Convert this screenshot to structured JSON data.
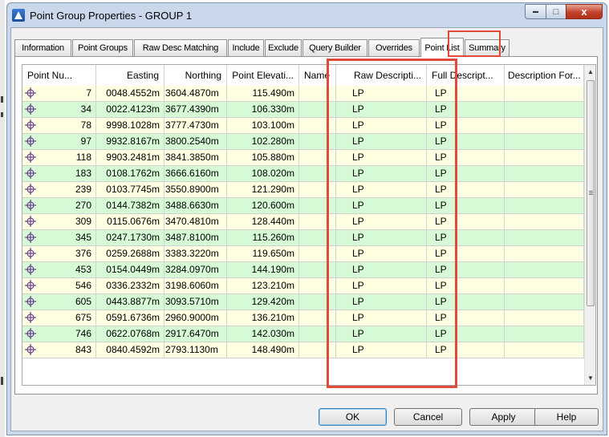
{
  "window": {
    "title": "Point Group Properties - GROUP 1"
  },
  "window_controls": {
    "minimize": "▬",
    "maximize": "□",
    "close": "x"
  },
  "tabs": [
    "Information",
    "Point Groups",
    "Raw Desc Matching",
    "Include",
    "Exclude",
    "Query Builder",
    "Overrides",
    "Point List",
    "Summary"
  ],
  "active_tab": "Point List",
  "columns": [
    "Point Nu...",
    "Easting",
    "Northing",
    "Point Elevati...",
    "Name",
    "Raw Descripti...",
    "Full Descript...",
    "Description For..."
  ],
  "rows": [
    {
      "number": "7",
      "easting": "0048.4552m",
      "northing": "3604.4870m",
      "elevation": "115.490m",
      "name": "",
      "raw_desc": "LP",
      "full_desc": "LP",
      "desc_format": ""
    },
    {
      "number": "34",
      "easting": "0022.4123m",
      "northing": "3677.4390m",
      "elevation": "106.330m",
      "name": "",
      "raw_desc": "LP",
      "full_desc": "LP",
      "desc_format": ""
    },
    {
      "number": "78",
      "easting": "9998.1028m",
      "northing": "3777.4730m",
      "elevation": "103.100m",
      "name": "",
      "raw_desc": "LP",
      "full_desc": "LP",
      "desc_format": ""
    },
    {
      "number": "97",
      "easting": "9932.8167m",
      "northing": "3800.2540m",
      "elevation": "102.280m",
      "name": "",
      "raw_desc": "LP",
      "full_desc": "LP",
      "desc_format": ""
    },
    {
      "number": "118",
      "easting": "9903.2481m",
      "northing": "3841.3850m",
      "elevation": "105.880m",
      "name": "",
      "raw_desc": "LP",
      "full_desc": "LP",
      "desc_format": ""
    },
    {
      "number": "183",
      "easting": "0108.1762m",
      "northing": "3666.6160m",
      "elevation": "108.020m",
      "name": "",
      "raw_desc": "LP",
      "full_desc": "LP",
      "desc_format": ""
    },
    {
      "number": "239",
      "easting": "0103.7745m",
      "northing": "3550.8900m",
      "elevation": "121.290m",
      "name": "",
      "raw_desc": "LP",
      "full_desc": "LP",
      "desc_format": ""
    },
    {
      "number": "270",
      "easting": "0144.7382m",
      "northing": "3488.6630m",
      "elevation": "120.600m",
      "name": "",
      "raw_desc": "LP",
      "full_desc": "LP",
      "desc_format": ""
    },
    {
      "number": "309",
      "easting": "0115.0676m",
      "northing": "3470.4810m",
      "elevation": "128.440m",
      "name": "",
      "raw_desc": "LP",
      "full_desc": "LP",
      "desc_format": ""
    },
    {
      "number": "345",
      "easting": "0247.1730m",
      "northing": "3487.8100m",
      "elevation": "115.260m",
      "name": "",
      "raw_desc": "LP",
      "full_desc": "LP",
      "desc_format": ""
    },
    {
      "number": "376",
      "easting": "0259.2688m",
      "northing": "3383.3220m",
      "elevation": "119.650m",
      "name": "",
      "raw_desc": "LP",
      "full_desc": "LP",
      "desc_format": ""
    },
    {
      "number": "453",
      "easting": "0154.0449m",
      "northing": "3284.0970m",
      "elevation": "144.190m",
      "name": "",
      "raw_desc": "LP",
      "full_desc": "LP",
      "desc_format": ""
    },
    {
      "number": "546",
      "easting": "0336.2332m",
      "northing": "3198.6060m",
      "elevation": "123.210m",
      "name": "",
      "raw_desc": "LP",
      "full_desc": "LP",
      "desc_format": ""
    },
    {
      "number": "605",
      "easting": "0443.8877m",
      "northing": "3093.5710m",
      "elevation": "129.420m",
      "name": "",
      "raw_desc": "LP",
      "full_desc": "LP",
      "desc_format": ""
    },
    {
      "number": "675",
      "easting": "0591.6736m",
      "northing": "2960.9000m",
      "elevation": "136.210m",
      "name": "",
      "raw_desc": "LP",
      "full_desc": "LP",
      "desc_format": ""
    },
    {
      "number": "746",
      "easting": "0622.0768m",
      "northing": "2917.6470m",
      "elevation": "142.030m",
      "name": "",
      "raw_desc": "LP",
      "full_desc": "LP",
      "desc_format": ""
    },
    {
      "number": "843",
      "easting": "0840.4592m",
      "northing": "2793.1130m",
      "elevation": "148.490m",
      "name": "",
      "raw_desc": "LP",
      "full_desc": "LP",
      "desc_format": ""
    }
  ],
  "buttons": {
    "ok": "OK",
    "cancel": "Cancel",
    "apply": "Apply",
    "help": "Help"
  },
  "colors": {
    "row_yellow": "#ffffe1",
    "row_green": "#d6f9d6",
    "highlight": "#e04a3c"
  },
  "icons": {
    "point": "point-marker-icon",
    "app": "civil3d-app-icon"
  }
}
